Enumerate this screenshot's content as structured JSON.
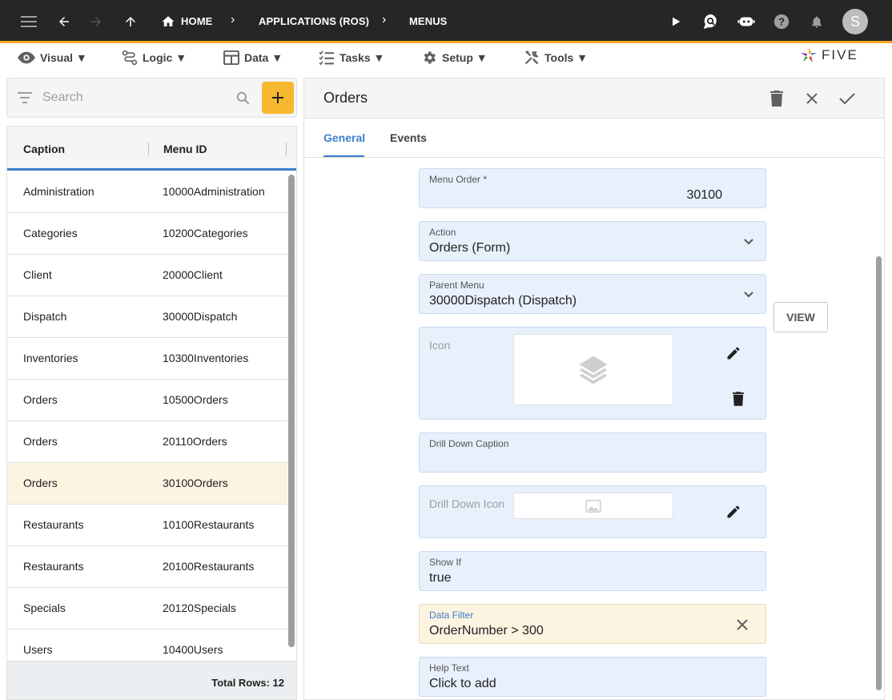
{
  "nav": {
    "crumbs": [
      "HOME",
      "APPLICATIONS (ROS)",
      "MENUS"
    ],
    "avatar_initial": "S"
  },
  "menubar": {
    "items": [
      "Visual ▼",
      "Logic ▼",
      "Data ▼",
      "Tasks ▼",
      "Setup ▼",
      "Tools ▼"
    ],
    "logo_text": "FIVE"
  },
  "sidebar": {
    "search_placeholder": "Search",
    "columns": [
      "Caption",
      "Menu ID"
    ],
    "rows": [
      {
        "caption": "Administration",
        "menu_id": "10000Administration"
      },
      {
        "caption": "Categories",
        "menu_id": "10200Categories"
      },
      {
        "caption": "Client",
        "menu_id": "20000Client"
      },
      {
        "caption": "Dispatch",
        "menu_id": "30000Dispatch"
      },
      {
        "caption": "Inventories",
        "menu_id": "10300Inventories"
      },
      {
        "caption": "Orders",
        "menu_id": "10500Orders"
      },
      {
        "caption": "Orders",
        "menu_id": "20110Orders"
      },
      {
        "caption": "Orders",
        "menu_id": "30100Orders"
      },
      {
        "caption": "Restaurants",
        "menu_id": "10100Restaurants"
      },
      {
        "caption": "Restaurants",
        "menu_id": "20100Restaurants"
      },
      {
        "caption": "Specials",
        "menu_id": "20120Specials"
      },
      {
        "caption": "Users",
        "menu_id": "10400Users"
      }
    ],
    "selected_index": 7,
    "total_rows": "Total Rows: 12"
  },
  "form": {
    "title": "Orders",
    "tabs": [
      "General",
      "Events"
    ],
    "active_tab": "General",
    "menu_order_label": "Menu Order *",
    "menu_order_value": "30100",
    "action_label": "Action",
    "action_value": "Orders (Form)",
    "view_label": "VIEW",
    "parent_menu_label": "Parent Menu",
    "parent_menu_value": "30000Dispatch (Dispatch)",
    "icon_label": "Icon",
    "drill_caption_label": "Drill Down Caption",
    "drill_caption_value": "",
    "drill_icon_label": "Drill Down Icon",
    "show_if_label": "Show If",
    "show_if_value": "true",
    "data_filter_label": "Data Filter",
    "data_filter_value": "OrderNumber > 300",
    "help_text_label": "Help Text",
    "help_text_value": "Click to add"
  },
  "colors": {
    "topbar": "#262626",
    "accent": "#f5a623",
    "link": "#3d7fcb",
    "field_bg": "#e7f0fb",
    "selected_row": "#fdf3e1"
  }
}
